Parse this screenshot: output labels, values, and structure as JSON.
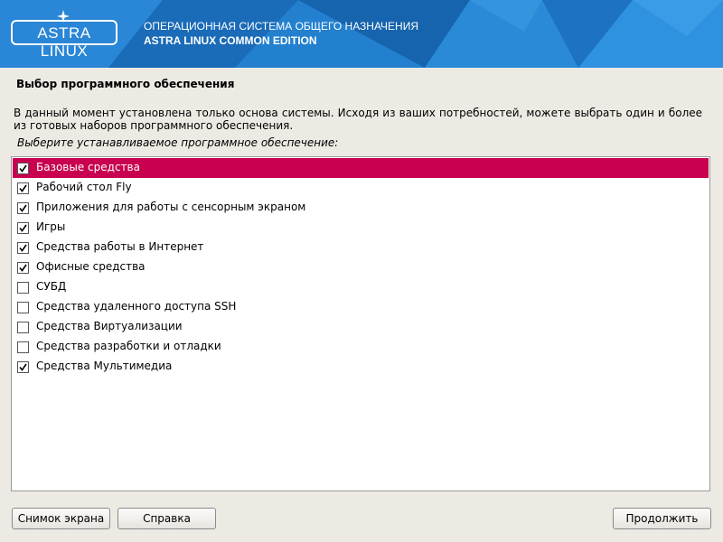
{
  "header": {
    "logo_text": "ASTRA LINUX",
    "line1": "ОПЕРАЦИОННАЯ СИСТЕМА ОБЩЕГО НАЗНАЧЕНИЯ",
    "line2": "ASTRA LINUX COMMON EDITION"
  },
  "page": {
    "title": "Выбор программного обеспечения",
    "description": "В данный момент установлена только основа системы. Исходя из ваших потребностей, можете выбрать один и более из готовых наборов программного обеспечения.",
    "prompt": "Выберите устанавливаемое программное обеспечение:"
  },
  "software": {
    "items": [
      {
        "label": "Базовые средства",
        "checked": true,
        "selected": true
      },
      {
        "label": "Рабочий стол Fly",
        "checked": true,
        "selected": false
      },
      {
        "label": "Приложения для работы с сенсорным экраном",
        "checked": true,
        "selected": false
      },
      {
        "label": "Игры",
        "checked": true,
        "selected": false
      },
      {
        "label": "Средства работы в Интернет",
        "checked": true,
        "selected": false
      },
      {
        "label": "Офисные средства",
        "checked": true,
        "selected": false
      },
      {
        "label": "СУБД",
        "checked": false,
        "selected": false
      },
      {
        "label": "Средства удаленного доступа SSH",
        "checked": false,
        "selected": false
      },
      {
        "label": "Средства Виртуализации",
        "checked": false,
        "selected": false
      },
      {
        "label": "Средства разработки и отладки",
        "checked": false,
        "selected": false
      },
      {
        "label": "Средства Мультимедиа",
        "checked": true,
        "selected": false
      }
    ]
  },
  "buttons": {
    "screenshot": "Снимок экрана",
    "help": "Справка",
    "continue": "Продолжить"
  },
  "colors": {
    "header_blue": "#1b74c4",
    "selection": "#c8004f",
    "background": "#edeae4"
  }
}
